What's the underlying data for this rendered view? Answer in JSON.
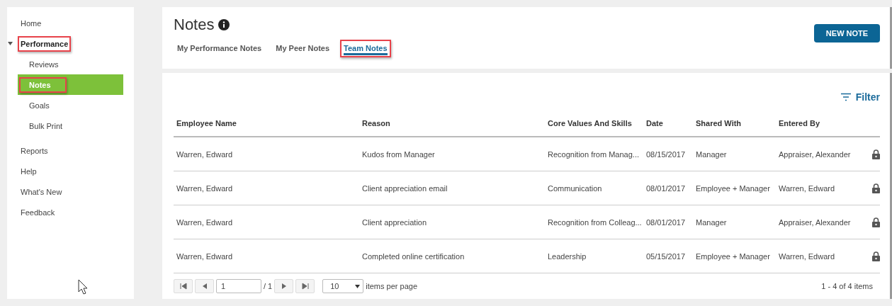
{
  "sidebar": {
    "items": [
      {
        "label": "Home",
        "highlighted": false
      },
      {
        "label": "Performance",
        "highlighted": true,
        "children": [
          {
            "label": "Reviews",
            "selected": false,
            "highlighted": false
          },
          {
            "label": "Notes",
            "selected": true,
            "highlighted": true
          },
          {
            "label": "Goals",
            "selected": false,
            "highlighted": false
          },
          {
            "label": "Bulk Print",
            "selected": false,
            "highlighted": false
          }
        ]
      },
      {
        "label": "Reports",
        "highlighted": false
      },
      {
        "label": "Help",
        "highlighted": false
      },
      {
        "label": "What's New",
        "highlighted": false
      },
      {
        "label": "Feedback",
        "highlighted": false
      }
    ]
  },
  "header": {
    "title": "Notes",
    "new_button": "NEW NOTE",
    "tabs": [
      {
        "label": "My Performance Notes",
        "selected": false,
        "highlighted": false
      },
      {
        "label": "My Peer Notes",
        "selected": false,
        "highlighted": false
      },
      {
        "label": "Team Notes",
        "selected": true,
        "highlighted": true
      }
    ]
  },
  "filter": "Filter",
  "table": {
    "columns": [
      "Employee Name",
      "Reason",
      "Core Values And Skills",
      "Date",
      "Shared With",
      "Entered By"
    ],
    "rows": [
      {
        "cells": [
          "Warren, Edward",
          "Kudos from Manager",
          "Recognition from Manag...",
          "08/15/2017",
          "Manager",
          "Appraiser, Alexander"
        ],
        "locked": true
      },
      {
        "cells": [
          "Warren, Edward",
          "Client appreciation email",
          "Communication",
          "08/01/2017",
          "Employee + Manager",
          "Warren, Edward"
        ],
        "locked": true
      },
      {
        "cells": [
          "Warren, Edward",
          "Client appreciation",
          "Recognition from Colleag...",
          "08/01/2017",
          "Manager",
          "Appraiser, Alexander"
        ],
        "locked": true
      },
      {
        "cells": [
          "Warren, Edward",
          "Completed online certification",
          "Leadership",
          "05/15/2017",
          "Employee + Manager",
          "Warren, Edward"
        ],
        "locked": true
      }
    ]
  },
  "pager": {
    "page": "1",
    "total": "/ 1",
    "page_size": "10",
    "per_page_label": "items per page",
    "summary": "1 - 4 of 4 items"
  }
}
